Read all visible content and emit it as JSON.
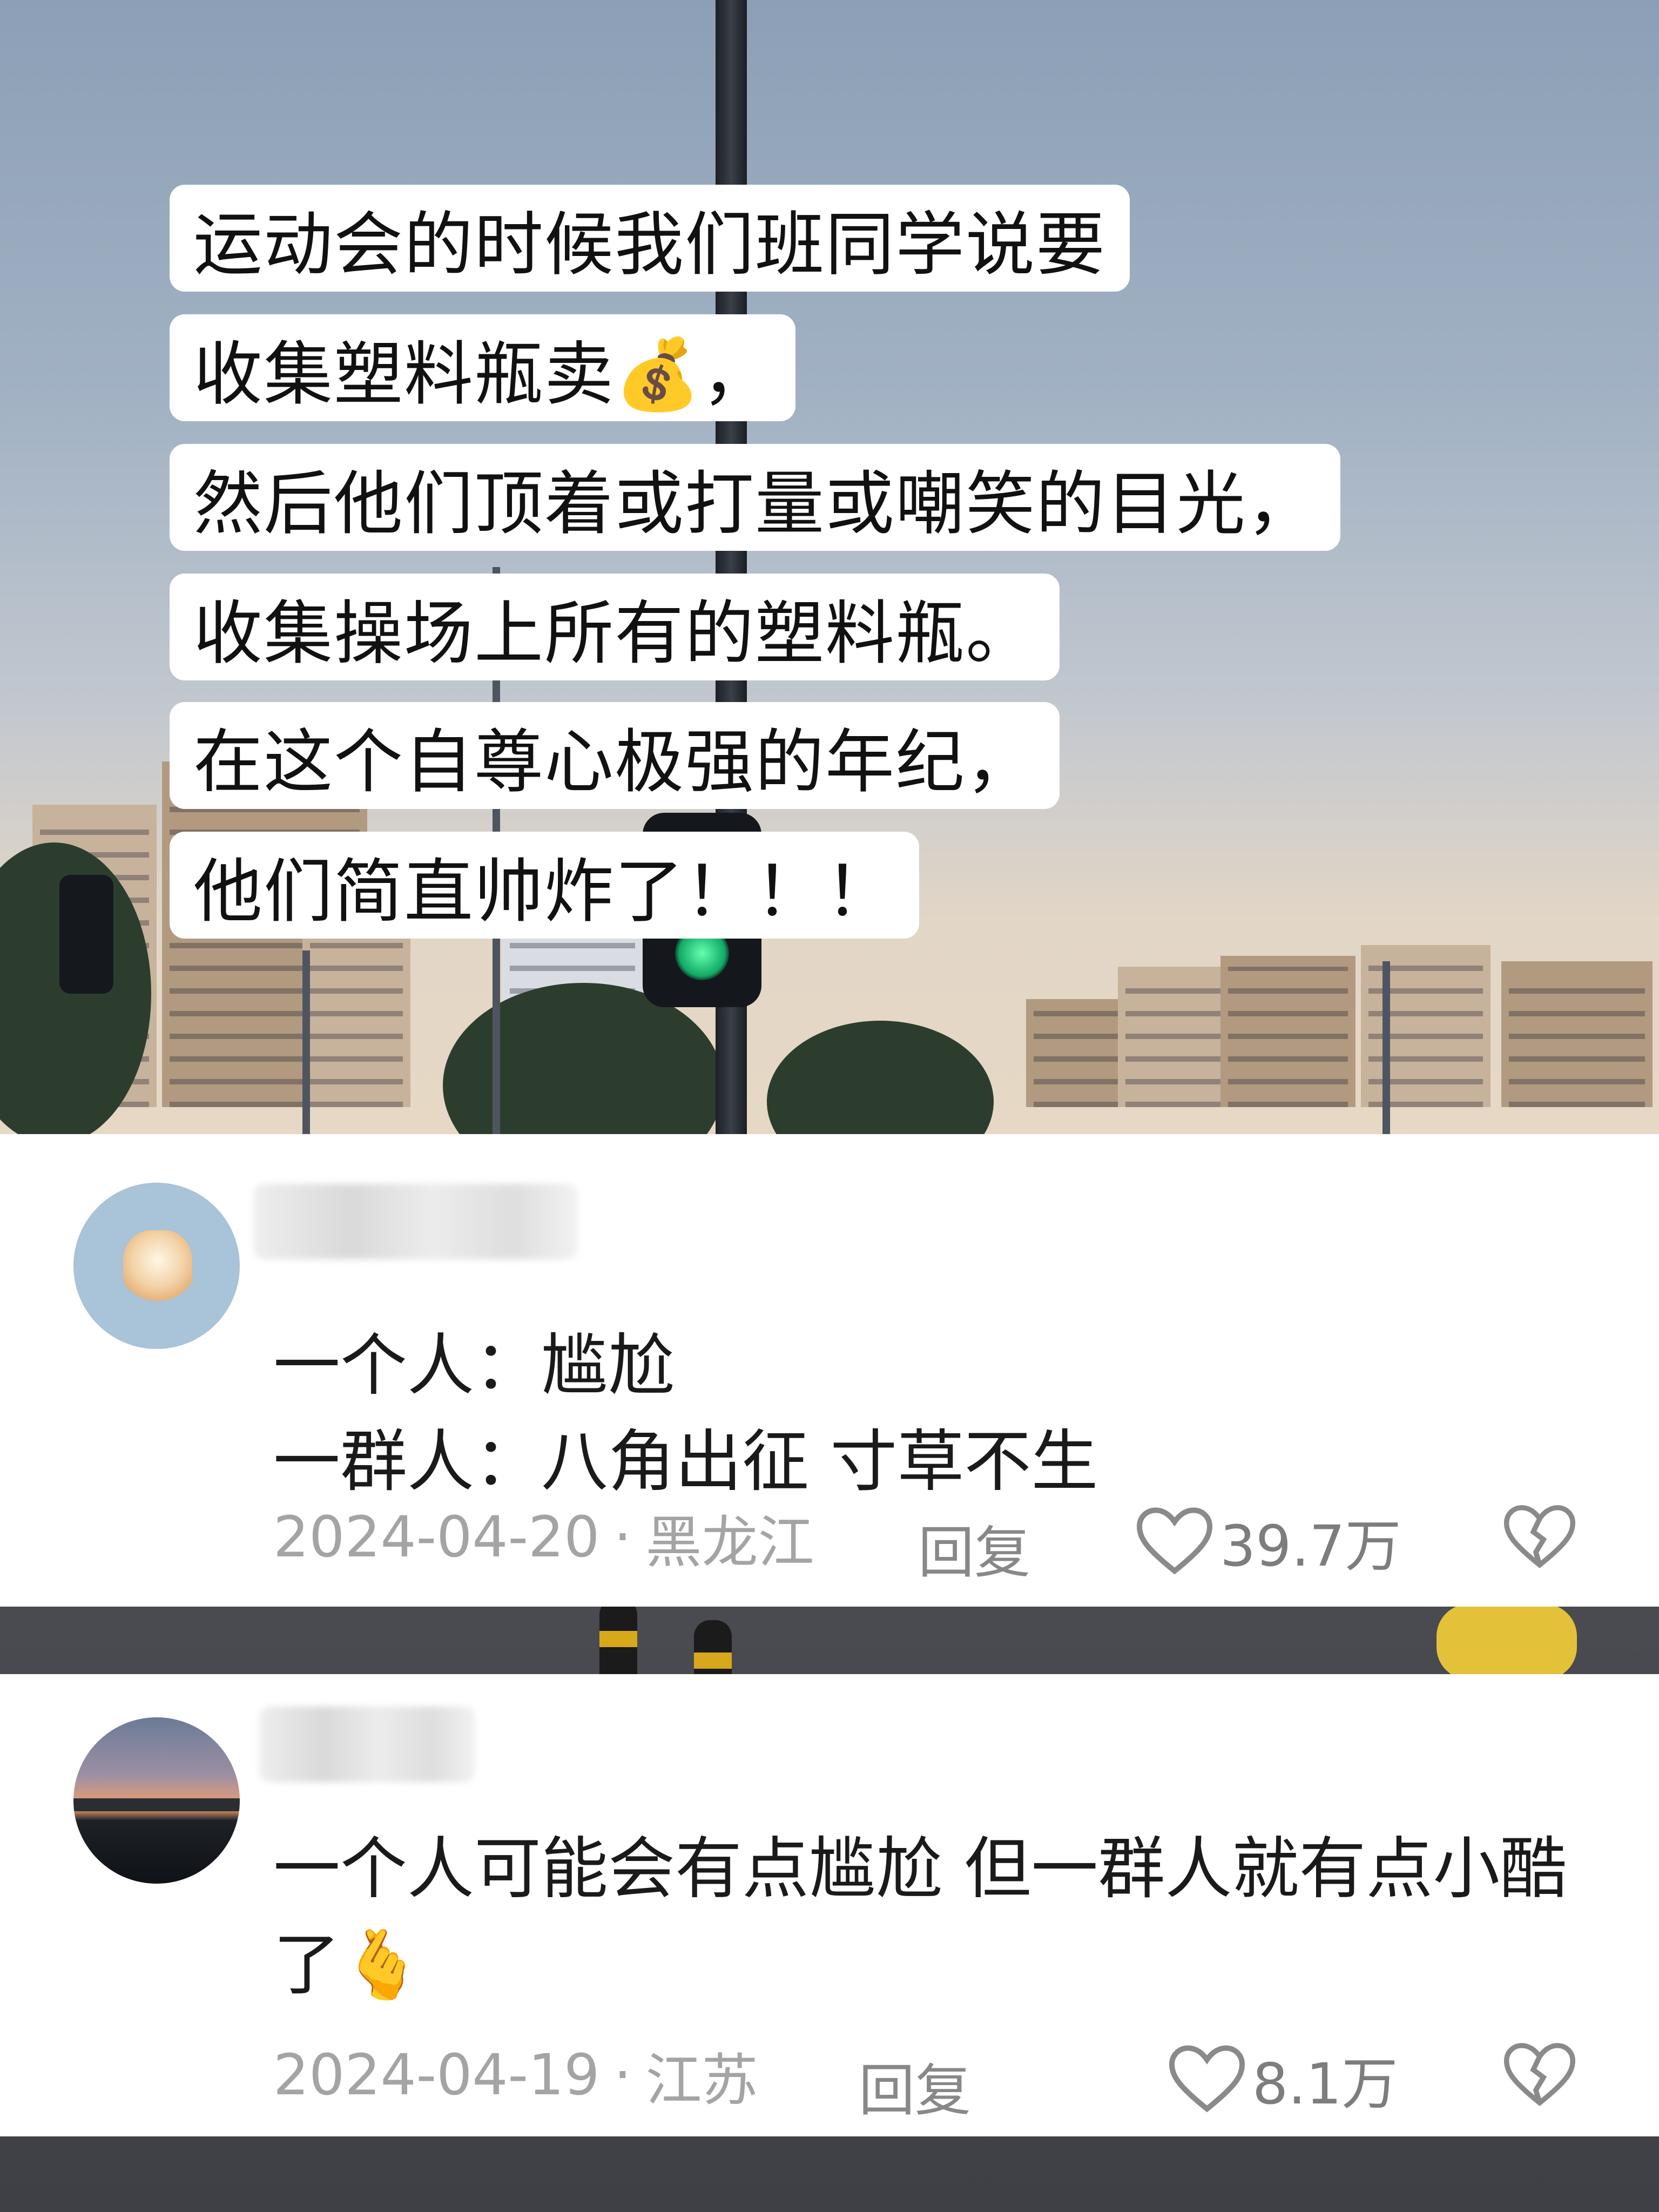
{
  "post": {
    "caption_lines": [
      "运动会的时候我们班同学说要",
      "收集塑料瓶卖💰，",
      "然后他们顶着或打量或嘲笑的目光，",
      "收集操场上所有的塑料瓶。",
      "在这个自尊心极强的年纪，",
      "他们简直帅炸了！！！"
    ]
  },
  "comments": [
    {
      "text_lines": [
        "一个人：尴尬",
        "一群人：八角出征 寸草不生"
      ],
      "date": "2024-04-20",
      "separator": "·",
      "location": "黑龙江",
      "reply_label": "回复",
      "likes": "39.7万",
      "avatar_icon": "cartoon-cat-avatar"
    },
    {
      "text_lines": [
        "一个人可能会有点尴尬 但一群人就有点小酷",
        "了🫰"
      ],
      "date": "2024-04-19",
      "separator": "·",
      "location": "江苏",
      "reply_label": "回复",
      "likes": "8.1万",
      "avatar_icon": "sunset-avatar"
    }
  ],
  "icons": {
    "like": "heart-icon",
    "dislike": "broken-heart-icon"
  },
  "colors": {
    "card_bg": "#ffffff",
    "meta_text": "#a4a4a4",
    "caption_bg": "#ffffff"
  }
}
